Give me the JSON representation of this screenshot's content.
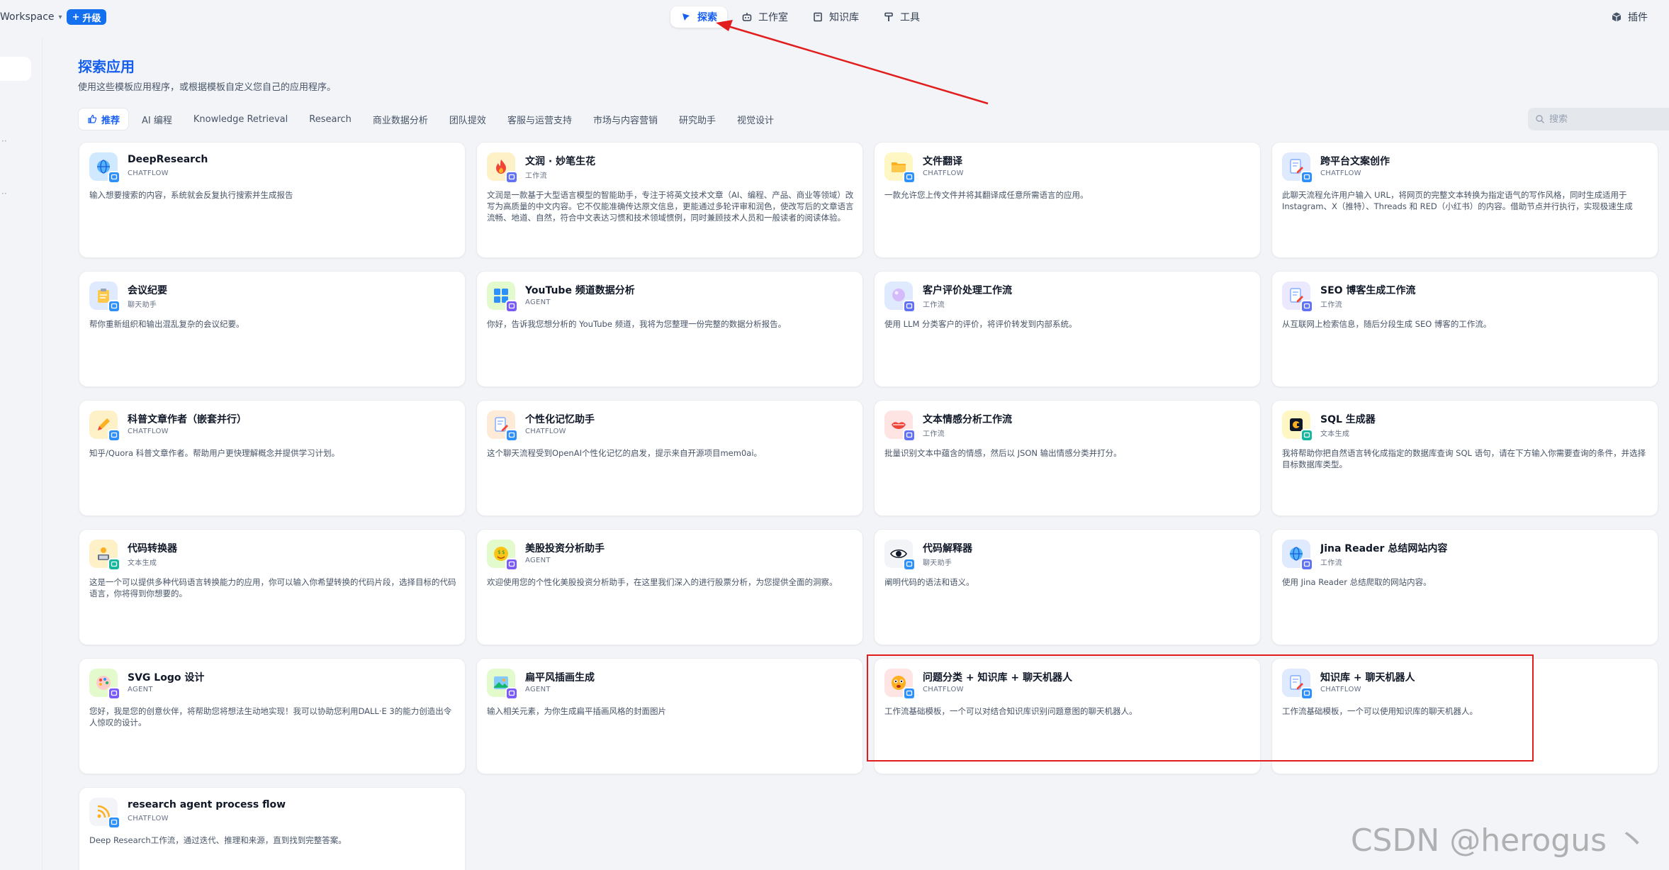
{
  "topbar": {
    "workspace": "Workspace",
    "upgrade": "升级",
    "nav": [
      {
        "label": "探索",
        "icon": "compass-icon",
        "active": true
      },
      {
        "label": "工作室",
        "icon": "robot-icon",
        "active": false
      },
      {
        "label": "知识库",
        "icon": "book-icon",
        "active": false
      },
      {
        "label": "工具",
        "icon": "hammer-icon",
        "active": false
      }
    ],
    "plugins": "插件"
  },
  "page": {
    "title": "探索应用",
    "subtitle": "使用这些模板应用程序，或根据模板自定义您自己的应用程序。"
  },
  "tabs": [
    {
      "label": "推荐",
      "active": true
    },
    {
      "label": "AI 编程",
      "active": false
    },
    {
      "label": "Knowledge Retrieval",
      "active": false
    },
    {
      "label": "Research",
      "active": false
    },
    {
      "label": "商业数据分析",
      "active": false
    },
    {
      "label": "团队提效",
      "active": false
    },
    {
      "label": "客服与运营支持",
      "active": false
    },
    {
      "label": "市场与内容营销",
      "active": false
    },
    {
      "label": "研究助手",
      "active": false
    },
    {
      "label": "视觉设计",
      "active": false
    }
  ],
  "search": {
    "placeholder": "搜索"
  },
  "cards": [
    {
      "name": "DeepResearch",
      "mode": "CHATFLOW",
      "desc": "输入想要搜索的内容，系统就会反复执行搜索并生成报告",
      "icon_bg": "#d1e9ff",
      "icon": "globe-icon",
      "badge": "#2e90fa"
    },
    {
      "name": "文润 · 妙笔生花",
      "mode": "工作流",
      "desc": "文润是一款基于大型语言模型的智能助手，专注于将英文技术文章（AI、编程、产品、商业等领域）改写为高质量的中文内容。它不仅能准确传达原文信息，更能通过多轮评审和润色，使改写后的文章语言流畅、地道、自然，符合中文表达习惯和技术领域惯例，同时兼顾技术人员和一般读者的阅读体验。",
      "icon_bg": "#fef0c7",
      "icon": "flame-icon",
      "badge": "#6172f3"
    },
    {
      "name": "文件翻译",
      "mode": "CHATFLOW",
      "desc": "一款允许您上传文件并将其翻译成任意所需语言的应用。",
      "icon_bg": "#fef7c3",
      "icon": "folder-icon",
      "badge": "#2e90fa"
    },
    {
      "name": "跨平台文案创作",
      "mode": "CHATFLOW",
      "desc": "此聊天流程允许用户输入 URL，将网页的完整文本转换为指定语气的写作风格，同时生成适用于 Instagram、X（推特）、Threads 和 RED（小红书）的内容。借助节点并行执行，实现极速生成",
      "icon_bg": "#e0eaff",
      "icon": "document-pen-icon",
      "badge": "#2e90fa"
    },
    {
      "name": "会议纪要",
      "mode": "聊天助手",
      "desc": "帮你重新组织和输出混乱复杂的会议纪要。",
      "icon_bg": "#e0eaff",
      "icon": "clipboard-icon",
      "badge": "#2e90fa"
    },
    {
      "name": "YouTube 频道数据分析",
      "mode": "AGENT",
      "desc": "你好，告诉我您想分析的 YouTube 频道，我将为您整理一份完整的数据分析报告。",
      "icon_bg": "#e3fbcc",
      "icon": "numbers-icon",
      "badge": "#7a5af8"
    },
    {
      "name": "客户评价处理工作流",
      "mode": "工作流",
      "desc": "使用 LLM 分类客户的评价，将评价转发到内部系统。",
      "icon_bg": "#e0eaff",
      "icon": "bubble-icon",
      "badge": "#6172f3"
    },
    {
      "name": "SEO 博客生成工作流",
      "mode": "工作流",
      "desc": "从互联网上检索信息，随后分段生成 SEO 博客的工作流。",
      "icon_bg": "#ebe9fe",
      "icon": "document-pen-icon",
      "badge": "#6172f3"
    },
    {
      "name": "科普文章作者（嵌套并行）",
      "mode": "CHATFLOW",
      "desc": "知乎/Quora 科普文章作者。帮助用户更快理解概念并提供学习计划。",
      "icon_bg": "#fef0c7",
      "icon": "pencil-icon",
      "badge": "#2e90fa"
    },
    {
      "name": "个性化记忆助手",
      "mode": "CHATFLOW",
      "desc": "这个聊天流程受到OpenAI个性化记忆的启发，提示来自开源项目mem0ai。",
      "icon_bg": "#fdead7",
      "icon": "document-pen-icon",
      "badge": "#2e90fa"
    },
    {
      "name": "文本情感分析工作流",
      "mode": "工作流",
      "desc": "批量识别文本中蕴含的情感，然后以 JSON 输出情感分类并打分。",
      "icon_bg": "#fee4e2",
      "icon": "lips-icon",
      "badge": "#6172f3"
    },
    {
      "name": "SQL 生成器",
      "mode": "文本生成",
      "desc": "我将帮助你把自然语言转化成指定的数据库查询 SQL 语句，请在下方输入你需要查询的条件，并选择目标数据库类型。",
      "icon_bg": "#fef7c3",
      "icon": "database-icon",
      "badge": "#15b79e"
    },
    {
      "name": "代码转换器",
      "mode": "文本生成",
      "desc": "这是一个可以提供多种代码语言转换能力的应用，你可以输入你希望转换的代码片段，选择目标的代码语言，你将得到你想要的。",
      "icon_bg": "#fef0c7",
      "icon": "person-laptop-icon",
      "badge": "#15b79e"
    },
    {
      "name": "美股投资分析助手",
      "mode": "AGENT",
      "desc": "欢迎使用您的个性化美股投资分析助手，在这里我们深入的进行股票分析，为您提供全面的洞察。",
      "icon_bg": "#e3fbcc",
      "icon": "money-face-icon",
      "badge": "#7a5af8"
    },
    {
      "name": "代码解释器",
      "mode": "聊天助手",
      "desc": "阐明代码的语法和语义。",
      "icon_bg": "#f2f4f7",
      "icon": "eye-icon",
      "badge": "#2e90fa"
    },
    {
      "name": "Jina Reader 总结网站内容",
      "mode": "工作流",
      "desc": "使用 Jina Reader 总结爬取的网站内容。",
      "icon_bg": "#e0eaff",
      "icon": "globe-icon",
      "badge": "#6172f3"
    },
    {
      "name": "SVG Logo 设计",
      "mode": "AGENT",
      "desc": "您好，我是您的创意伙伴，将帮助您将想法生动地实现！我可以协助您利用DALL·E 3的能力创造出令人惊叹的设计。",
      "icon_bg": "#e3fbcc",
      "icon": "palette-icon",
      "badge": "#7a5af8"
    },
    {
      "name": "扁平风插画生成",
      "mode": "AGENT",
      "desc": "输入相关元素，为你生成扁平插画风格的封面图片",
      "icon_bg": "#e3fbcc",
      "icon": "picture-icon",
      "badge": "#7a5af8"
    },
    {
      "name": "问题分类 + 知识库 + 聊天机器人",
      "mode": "CHATFLOW",
      "desc": "工作流基础模板，一个可以对结合知识库识别问题意图的聊天机器人。",
      "icon_bg": "#fee4e2",
      "icon": "emoji-face-icon",
      "badge": "#2e90fa"
    },
    {
      "name": "知识库 + 聊天机器人",
      "mode": "CHATFLOW",
      "desc": "工作流基础模板，一个可以使用知识库的聊天机器人。",
      "icon_bg": "#e0eaff",
      "icon": "document-pen-icon",
      "badge": "#2e90fa"
    },
    {
      "name": "research agent process flow",
      "mode": "CHATFLOW",
      "desc": "Deep Research工作流，通过迭代、推理和来源，直到找到完整答案。",
      "icon_bg": "#f2f4f7",
      "icon": "rss-icon",
      "badge": "#2e90fa"
    }
  ],
  "watermark": "CSDN @herogus 丶",
  "colors": {
    "accent": "#155eef",
    "annotation": "#e11d1d"
  }
}
